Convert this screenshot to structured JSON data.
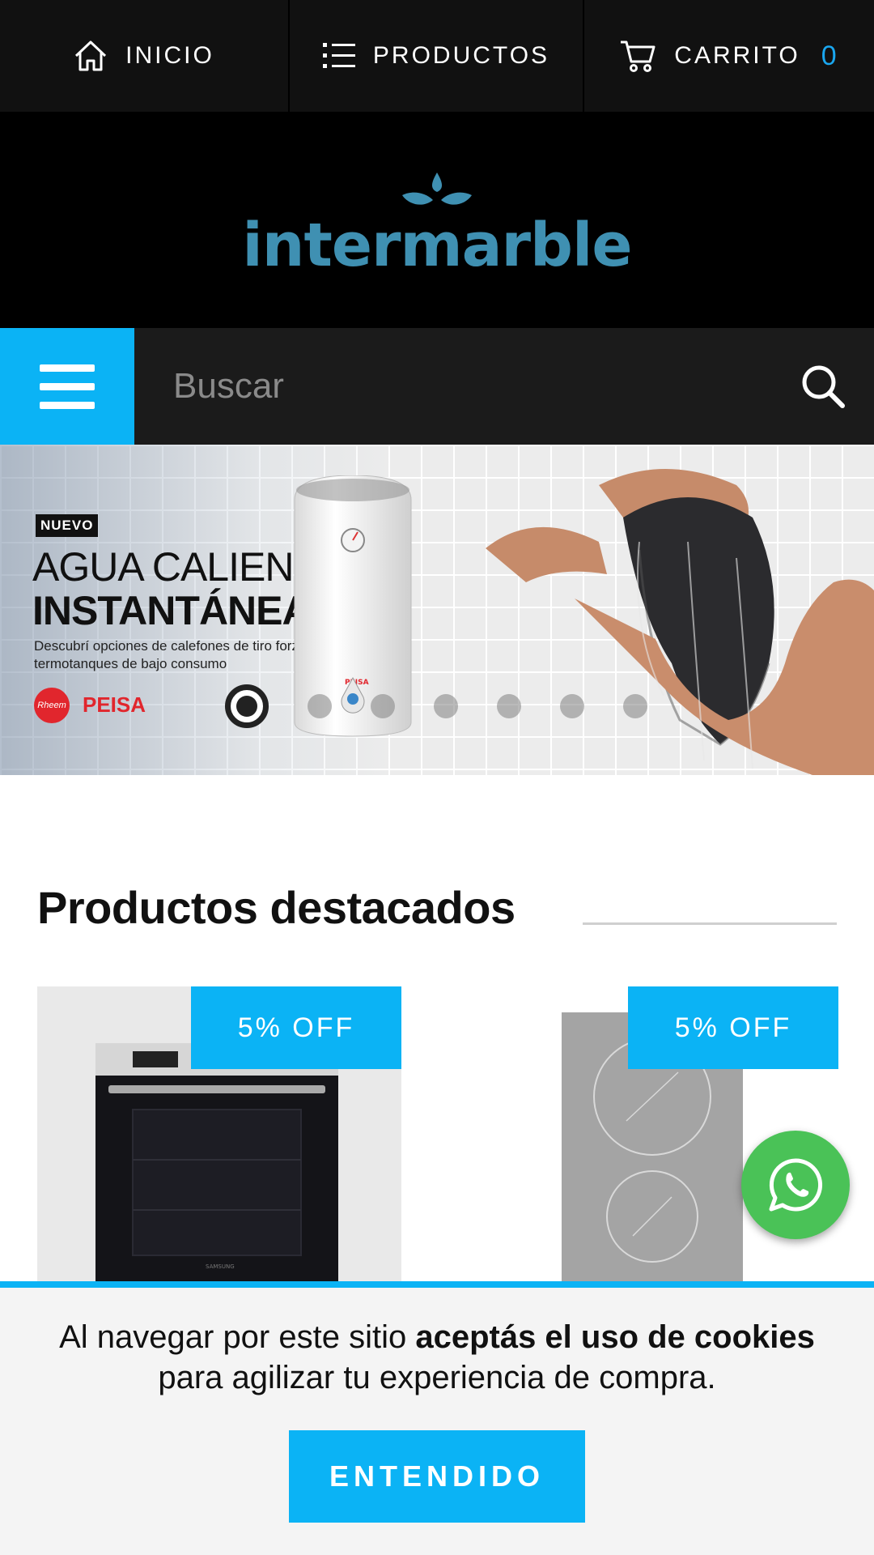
{
  "nav": {
    "inicio_label": "INICIO",
    "productos_label": "PRODUCTOS",
    "carrito_label": "CARRITO",
    "cart_count": "0"
  },
  "logo": {
    "text": "intermarble"
  },
  "search": {
    "placeholder": "Buscar"
  },
  "banner": {
    "badge": "NUEVO",
    "heading_line1": "AGUA CALIENTE",
    "heading_line2": "INSTANTÁNEA",
    "subtitle": "Descubrí opciones de calefones de tiro forzado y termotanques de bajo consumo",
    "brand_1": "Rheem",
    "brand_2": "PEISA",
    "heater_brand": "PEISA",
    "slide_count": 7,
    "active_slide": 1
  },
  "featured": {
    "title": "Productos destacados",
    "products": [
      {
        "badge": "5% OFF",
        "image": "samsung-built-in-oven",
        "oven_brand": "SAMSUNG"
      },
      {
        "badge": "5% OFF",
        "image": "electric-cooktop"
      }
    ]
  },
  "cookie": {
    "text_before": "Al navegar por este sitio ",
    "text_bold": "aceptás el uso de cookies",
    "text_after": "para agilizar tu experiencia de compra.",
    "button_label": "ENTENDIDO"
  },
  "colors": {
    "accent": "#0bb3f5",
    "nav_bg": "#111111",
    "logo": "#3f90b2",
    "whatsapp": "#4ac257",
    "brand_red": "#e1262d"
  },
  "icons": [
    "home-icon",
    "list-icon",
    "cart-icon",
    "menu-icon",
    "search-icon",
    "whatsapp-icon"
  ]
}
